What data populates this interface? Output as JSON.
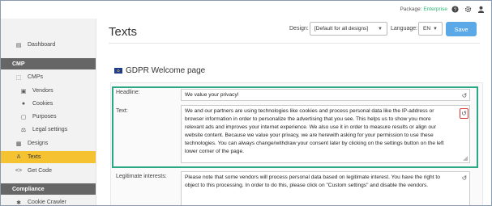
{
  "topbar": {
    "package_label": "Package:",
    "package_value": "Enterprise",
    "icons": [
      "help-icon",
      "gear-icon",
      "user-icon"
    ]
  },
  "sidebar": {
    "dashboard": "Dashboard",
    "cmp_header": "CMP",
    "cmps": "CMPs",
    "vendors": "Vendors",
    "cookies": "Cookies",
    "purposes": "Purposes",
    "legal_settings": "Legal settings",
    "designs": "Designs",
    "texts": "Texts",
    "get_code": "Get Code",
    "compliance_header": "Compliance",
    "cookie_crawler": "Cookie Crawler"
  },
  "header": {
    "title": "Texts",
    "design_label": "Design:",
    "design_value": "[Default for all designs]",
    "language_label": "Language:",
    "language_value": "EN",
    "save_label": "Save"
  },
  "page": {
    "heading": "GDPR Welcome page"
  },
  "fields": {
    "headline_label": "Headline:",
    "headline_value": "We value your privacy!",
    "text_label": "Text:",
    "text_lines": [
      "We and our partners are using technologies like cookies and process personal data like the IP-address or",
      "browser information in order to personalize the advertising that you see. This helps us to show you more",
      "relevant ads and improves your internet experience. We also use it in order to measure results or align our",
      "website content. Because we value your privacy, we are herewith asking for your permission to use these",
      "technologies. You can always change/withdraw your consent later by clicking on the settings button on the left",
      "lower corner of the page."
    ],
    "legit_label": "Legitimate interests:",
    "legit_lines": [
      "Please note that some vendors will process personal data based on legitimate interest. You have the right to",
      "object to this processing. In order to do this, please click on \"Custom settings\" and disable the vendors."
    ]
  },
  "colors": {
    "accent_blue": "#5aa9e6",
    "highlight_green": "#2aa783",
    "active_yellow": "#f5c332",
    "reset_red": "#d33333"
  }
}
